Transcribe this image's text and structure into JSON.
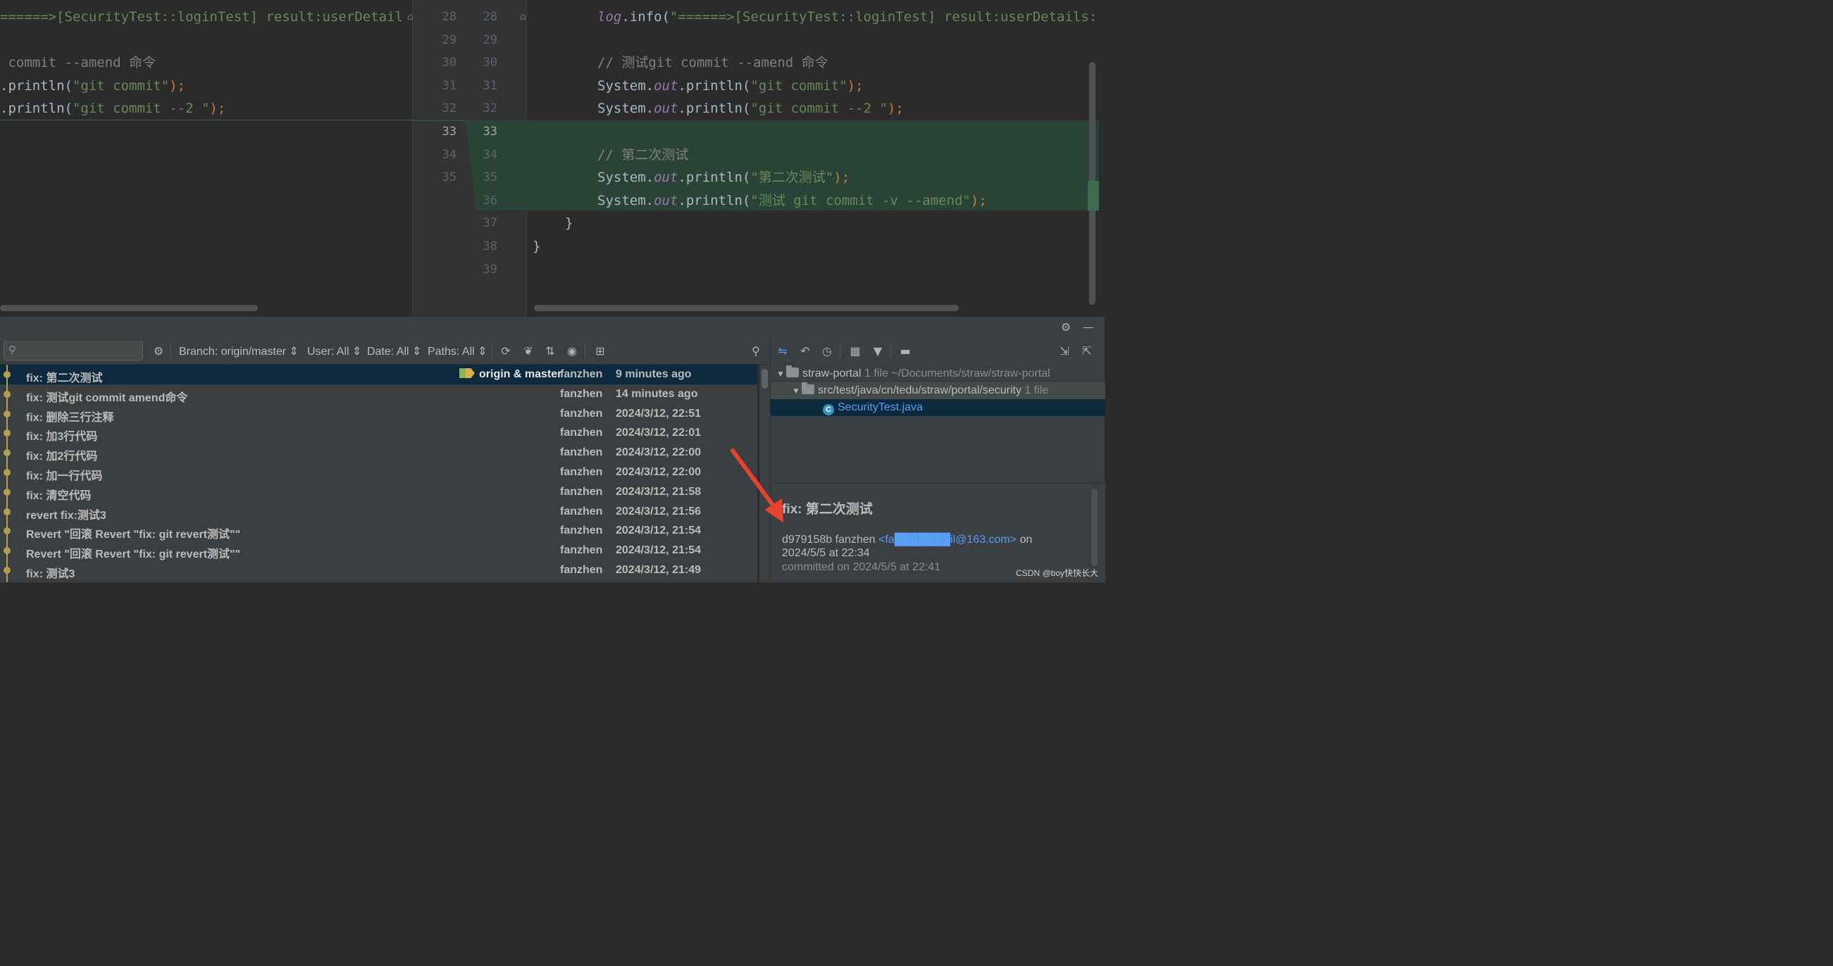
{
  "diff": {
    "left_lines": [
      {
        "segments": [
          {
            "t": "======>[SecurityTest::loginTest] result:userDetail",
            "c": "k-str"
          }
        ]
      },
      {
        "segments": []
      },
      {
        "segments": [
          {
            "t": " commit --amend 命令",
            "c": "k-cmt"
          }
        ]
      },
      {
        "segments": [
          {
            "t": ".println(",
            "c": ""
          },
          {
            "t": "\"git commit\"",
            "c": "k-str"
          },
          {
            "t": ");",
            "c": "k-semi"
          }
        ]
      },
      {
        "segments": [
          {
            "t": ".println(",
            "c": ""
          },
          {
            "t": "\"git commit --2 \"",
            "c": "k-str"
          },
          {
            "t": ");",
            "c": "k-semi"
          }
        ]
      }
    ],
    "left_numbers": [
      "28",
      "29",
      "30",
      "31",
      "32",
      "33",
      "34",
      "35"
    ],
    "right_numbers": [
      "28",
      "29",
      "30",
      "31",
      "32",
      "33",
      "34",
      "35",
      "36",
      "37",
      "38",
      "39"
    ],
    "right_lines": [
      {
        "segments": [
          {
            "t": "log",
            "c": "k-log"
          },
          {
            "t": ".info(",
            "c": ""
          },
          {
            "t": "\"======>[SecurityTest::loginTest] result:userDetails:",
            "c": "k-str"
          }
        ]
      },
      {
        "segments": []
      },
      {
        "segments": [
          {
            "t": "// 测试git commit --amend 命令",
            "c": "k-cmt"
          }
        ]
      },
      {
        "segments": [
          {
            "t": "System.",
            "c": ""
          },
          {
            "t": "out",
            "c": "k-fld"
          },
          {
            "t": ".println(",
            "c": ""
          },
          {
            "t": "\"git commit\"",
            "c": "k-str"
          },
          {
            "t": ");",
            "c": "k-semi"
          }
        ]
      },
      {
        "segments": [
          {
            "t": "System.",
            "c": ""
          },
          {
            "t": "out",
            "c": "k-fld"
          },
          {
            "t": ".println(",
            "c": ""
          },
          {
            "t": "\"git commit --2 \"",
            "c": "k-str"
          },
          {
            "t": ");",
            "c": "k-semi"
          }
        ]
      },
      {
        "segments": []
      },
      {
        "segments": [
          {
            "t": "// 第二次测试",
            "c": "k-cmt"
          }
        ]
      },
      {
        "segments": [
          {
            "t": "System.",
            "c": ""
          },
          {
            "t": "out",
            "c": "k-fld"
          },
          {
            "t": ".println(",
            "c": ""
          },
          {
            "t": "\"第二次测试\"",
            "c": "k-str"
          },
          {
            "t": ");",
            "c": "k-semi"
          }
        ]
      },
      {
        "segments": [
          {
            "t": "System.",
            "c": ""
          },
          {
            "t": "out",
            "c": "k-fld"
          },
          {
            "t": ".println(",
            "c": ""
          },
          {
            "t": "\"测试 git commit -v --amend\"",
            "c": "k-str"
          },
          {
            "t": ");",
            "c": "k-semi"
          }
        ]
      },
      {
        "segments": [
          {
            "t": "}",
            "c": ""
          }
        ]
      },
      {
        "segments": [
          {
            "t": "}",
            "c": ""
          }
        ]
      },
      {
        "segments": []
      }
    ]
  },
  "log_toolbar": {
    "search_placeholder": "",
    "branch_filter": "Branch: origin/master ⇕",
    "user_filter": "User: All ⇕",
    "date_filter": "Date: All ⇕",
    "paths_filter": "Paths: All ⇕"
  },
  "commits": [
    {
      "message": "fix: 第二次测试",
      "refs": "origin & master",
      "author": "fanzhen",
      "date": "9 minutes ago",
      "selected": true
    },
    {
      "message": "fix: 测试git commit amend命令",
      "refs": "",
      "author": "fanzhen",
      "date": "14 minutes ago"
    },
    {
      "message": "fix: 删除三行注释",
      "refs": "",
      "author": "fanzhen",
      "date": "2024/3/12, 22:51"
    },
    {
      "message": "fix: 加3行代码",
      "refs": "",
      "author": "fanzhen",
      "date": "2024/3/12, 22:01"
    },
    {
      "message": "fix: 加2行代码",
      "refs": "",
      "author": "fanzhen",
      "date": "2024/3/12, 22:00"
    },
    {
      "message": "fix: 加一行代码",
      "refs": "",
      "author": "fanzhen",
      "date": "2024/3/12, 22:00"
    },
    {
      "message": "fix: 清空代码",
      "refs": "",
      "author": "fanzhen",
      "date": "2024/3/12, 21:58"
    },
    {
      "message": "revert fix:测试3",
      "refs": "",
      "author": "fanzhen",
      "date": "2024/3/12, 21:56"
    },
    {
      "message": "Revert \"回滚 Revert \"fix: git revert测试\"\"",
      "refs": "",
      "author": "fanzhen",
      "date": "2024/3/12, 21:54"
    },
    {
      "message": "Revert \"回滚 Revert \"fix: git revert测试\"\"",
      "refs": "",
      "author": "fanzhen",
      "date": "2024/3/12, 21:54"
    },
    {
      "message": "fix: 测试3",
      "refs": "",
      "author": "fanzhen",
      "date": "2024/3/12, 21:49"
    }
  ],
  "changes_tree": {
    "root_name": "straw-portal",
    "root_meta": "1 file  ~/Documents/straw/straw-portal",
    "dir_name": "src/test/java/cn/tedu/straw/portal/security",
    "dir_meta": "1 file",
    "file_name": "SecurityTest.java"
  },
  "commit_details": {
    "title": "fix: 第二次测试",
    "hash_author": "d979158b fanzhen ",
    "email": "<fa███████il@163.com>",
    "on_word": " on",
    "authored_date": "2024/5/5 at 22:34",
    "committed": "committed on 2024/5/5 at 22:41"
  },
  "watermark": "CSDN @boy快快长大",
  "colors": {
    "editor_bg": "#2b2b2b",
    "panel_bg": "#3c3f41",
    "selection": "#0d293e",
    "added_hunk": "#294436",
    "graph": "#b19e52",
    "annotation_arrow": "#e8412c"
  }
}
